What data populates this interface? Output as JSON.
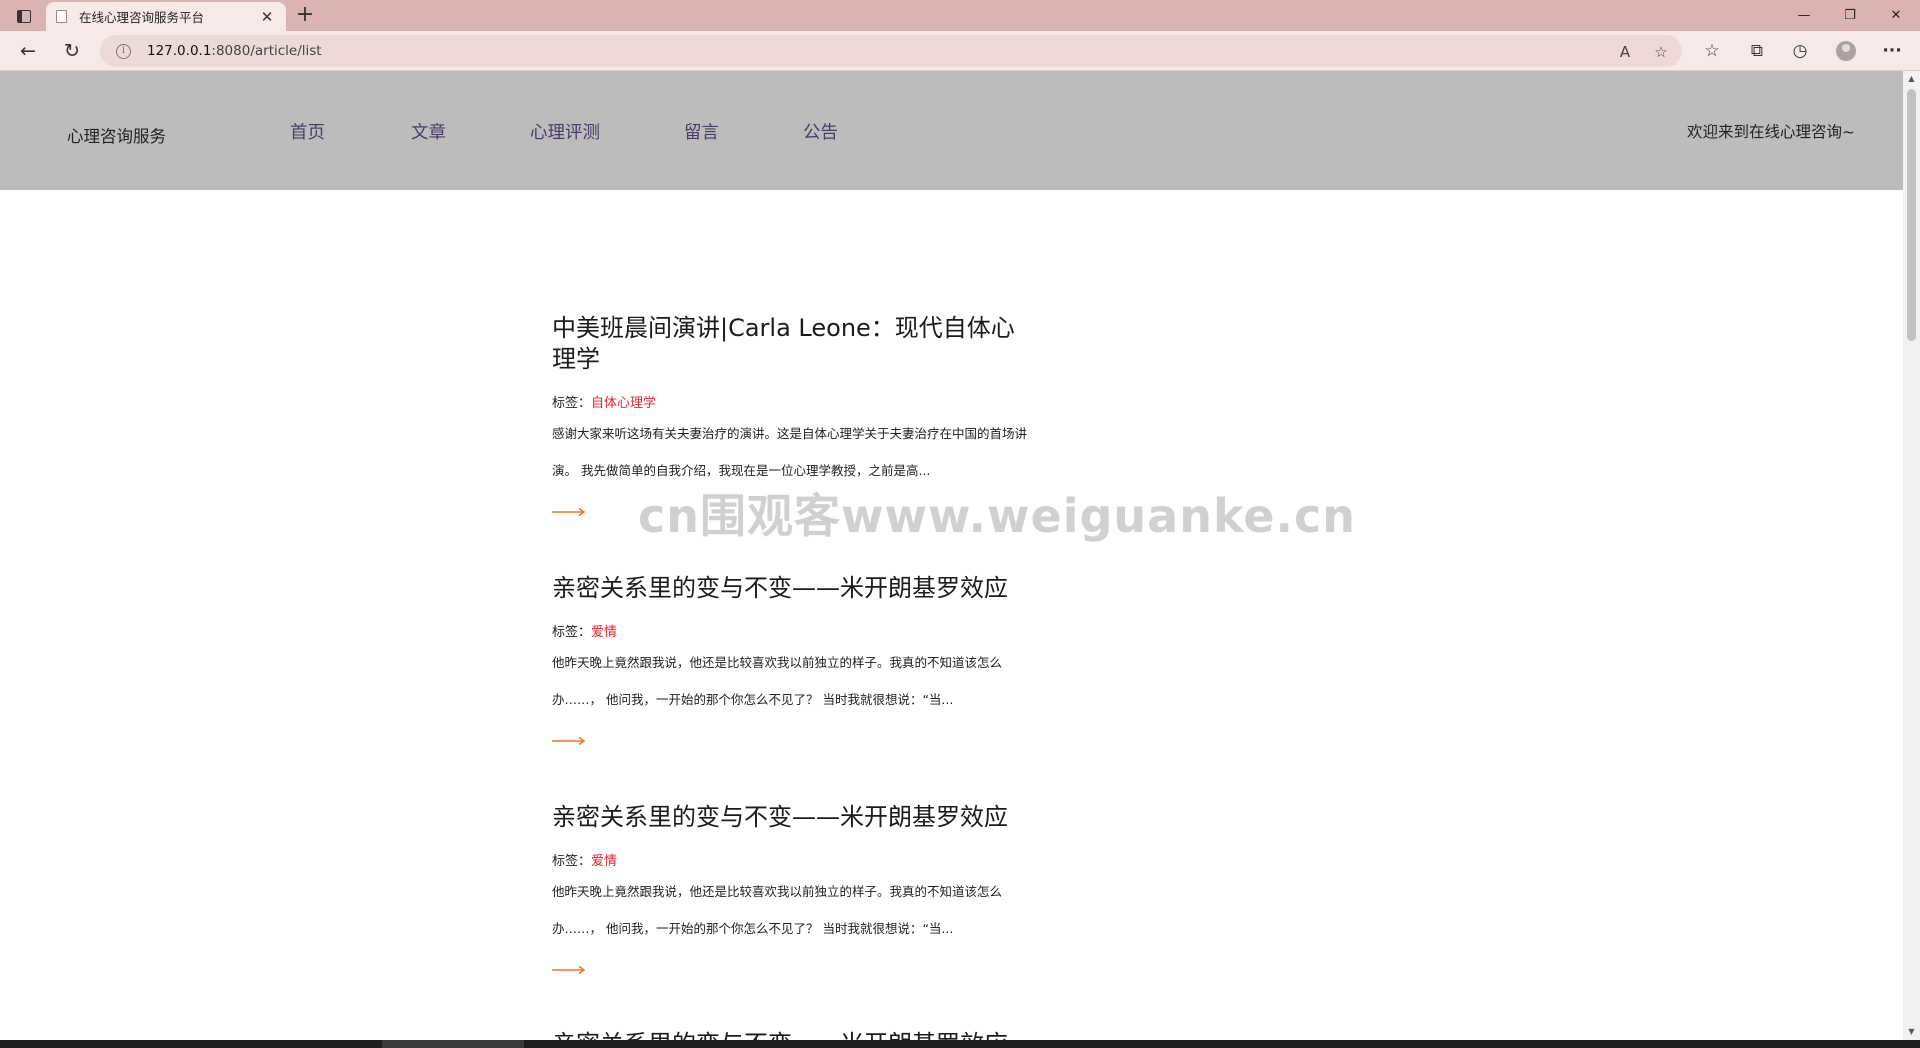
{
  "browser": {
    "tab_title": "在线心理咨询服务平台",
    "tab_close": "✕",
    "new_tab": "+",
    "url_host": "127.0.0.1",
    "url_rest": ":8080/article/list",
    "info_glyph": "i",
    "window_controls": {
      "minimize": "—",
      "restore": "❐",
      "close": "✕"
    },
    "toolbar_icons": [
      "read-aloud-icon",
      "add-favorite-icon",
      "favorites-icon",
      "collections-icon",
      "history-icon",
      "profile-icon",
      "more-icon"
    ],
    "tool_glyphs": {
      "read_aloud": "A",
      "add_favorite": "☆",
      "favorites": "☆",
      "collections": "⧉",
      "history": "◷",
      "more": "···"
    },
    "nav_glyphs": {
      "back": "←",
      "refresh": "↻"
    }
  },
  "site": {
    "logo": "心理咨询服务",
    "nav": [
      {
        "label": "首页"
      },
      {
        "label": "文章"
      },
      {
        "label": "心理评测"
      },
      {
        "label": "留言"
      },
      {
        "label": "公告"
      }
    ],
    "welcome": "欢迎来到在线心理咨询~"
  },
  "articles": [
    {
      "title": "中美班晨间演讲|Carla Leone：现代自体心理学",
      "tag_label": "标签：",
      "tag": "自体心理学",
      "excerpt": "感谢大家来听这场有关夫妻治疗的演讲。这是自体心理学关于夫妻治疗在中国的首场讲演。 我先做简单的自我介绍，我现在是一位心理学教授，之前是高..."
    },
    {
      "title": "亲密关系里的变与不变——米开朗基罗效应",
      "tag_label": "标签：",
      "tag": "爱情",
      "excerpt": "他昨天晚上竟然跟我说，他还是比较喜欢我以前独立的样子。我真的不知道该怎么办……， 他问我，一开始的那个你怎么不见了？ 当时我就很想说：“当..."
    },
    {
      "title": "亲密关系里的变与不变——米开朗基罗效应",
      "tag_label": "标签：",
      "tag": "爱情",
      "excerpt": "他昨天晚上竟然跟我说，他还是比较喜欢我以前独立的样子。我真的不知道该怎么办……， 他问我，一开始的那个你怎么不见了？ 当时我就很想说：“当..."
    },
    {
      "title": "亲密关系里的变与不变——米开朗基罗效应"
    }
  ],
  "watermark": "cn围观客www.weiguanke.cn",
  "colors": {
    "accent_tag": "#e8232b",
    "arrow": "#f07a24",
    "header_bg": "#bcbcbc",
    "tabbar_bg": "#dbb3b0"
  }
}
